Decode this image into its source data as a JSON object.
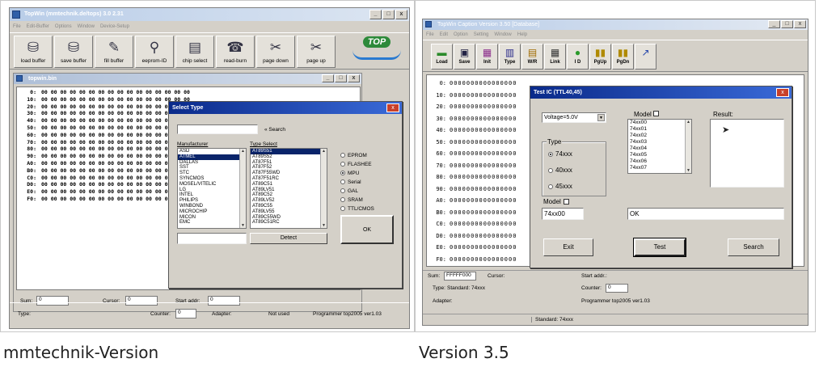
{
  "captions": [
    "mmtechnik-Version",
    "Version 3.5"
  ],
  "left": {
    "title": "TopWin (mmtechnik.de/tops) 3.0 2.31",
    "menu": [
      "File",
      "Edit-Buffer",
      "Options",
      "Window",
      "Device-Setup"
    ],
    "toolbar": [
      "load buffer",
      "save buffer",
      "fill buffer",
      "eeprom-ID",
      "chip select",
      "read-burn",
      "page down",
      "page up"
    ],
    "logo_text": "TOP",
    "doc_title": "topwin.bin",
    "hex_offsets": [
      "0:",
      "10:",
      "20:",
      "30:",
      "40:",
      "50:",
      "60:",
      "70:",
      "80:",
      "90:",
      "A0:",
      "B0:",
      "C0:",
      "D0:",
      "E0:",
      "F0:"
    ],
    "hex_fill": "00 00 00 00 00 00 00 00 00 00 00 00 00 00 00 00",
    "sum_label": "Sum:",
    "sum_value": "0",
    "cursor_label": "Cursor:",
    "cursor_value": "0",
    "startaddr_label": "Start addr:",
    "startaddr_value": "0",
    "status": {
      "type_label": "Type:",
      "counter_label": "Counter:",
      "counter_value": "0",
      "adapter_label": "Adapter:",
      "notused": "Not used",
      "program": "Programmer top2005 ver1.03"
    },
    "dialog": {
      "title": "Select Type",
      "search_label": "« Search",
      "manufacturer_header": "Manufacturer",
      "type_header": "Type Select",
      "manufacturers": [
        "ASD",
        "ATMEL",
        "DALLAS",
        "SST",
        "STC",
        "SYNCMOS",
        "MOSEL/VITELIC",
        "LG",
        "INTEL",
        "PHILIPS",
        "WINBOND",
        "MICROCHIP",
        "MICON",
        "EMC"
      ],
      "manufacturer_selected": 1,
      "types": [
        "AT89S51",
        "AT89S52",
        "AT87F51",
        "AT87F52",
        "AT87F55WD",
        "AT87F51RC",
        "AT89C51",
        "AT89LV51",
        "AT89C52",
        "AT89LV52",
        "AT89C55",
        "AT89LV55",
        "AT89C55WD",
        "AT89C51RC"
      ],
      "type_selected": 0,
      "categories": [
        "EPROM",
        "FLASHEE",
        "MPU",
        "Serial",
        "GAL",
        "SRAM",
        "TTL/CMOS"
      ],
      "category_selected": 2,
      "ok_label": "OK",
      "detect_label": "Detect"
    }
  },
  "right": {
    "title": "TopWin  Caption  Version 3.50   [Database]",
    "menu": [
      "File",
      "Edit",
      "Option",
      "Setting",
      "Window",
      "Help"
    ],
    "toolbar": [
      "Load",
      "Save",
      "Init",
      "Type",
      "W/R",
      "Link",
      "I D",
      "PgUp",
      "PgDn",
      ""
    ],
    "hex_offsets": [
      "0:",
      "10:",
      "20:",
      "30:",
      "40:",
      "50:",
      "60:",
      "70:",
      "80:",
      "90:",
      "A0:",
      "B0:",
      "C0:",
      "D0:",
      "E0:",
      "F0:"
    ],
    "hex_fill": "0000000000000000",
    "sum_label": "Sum:",
    "sum_value": "FFFFF000",
    "cursor_label": "Cursor:",
    "startaddr_label": "Start addr.:",
    "type_label": "Type:",
    "type_value": "Standard: 74xxx",
    "counter_label": "Counter:",
    "counter_value": "0",
    "adapter_label": "Adapter:",
    "program": "Programmer top2005 ver1.03",
    "bottom_status": "Standard: 74xxx",
    "dialog": {
      "title": "Test IC (TTL40,45)",
      "voltage": "Voltage=5.0V",
      "type_group": "Type",
      "types": [
        "74xxx",
        "40xxx",
        "45xxx"
      ],
      "type_selected": 0,
      "model_list_label": "Model",
      "models": [
        "74xx00",
        "74xx01",
        "74xx02",
        "74xx03",
        "74xx04",
        "74xx05",
        "74xx06",
        "74xx07"
      ],
      "result_label": "Result:",
      "model_label": "Model",
      "model_value": "74xx00",
      "result_value": "OK",
      "exit_label": "Exit",
      "test_label": "Test",
      "search_label": "Search"
    }
  }
}
